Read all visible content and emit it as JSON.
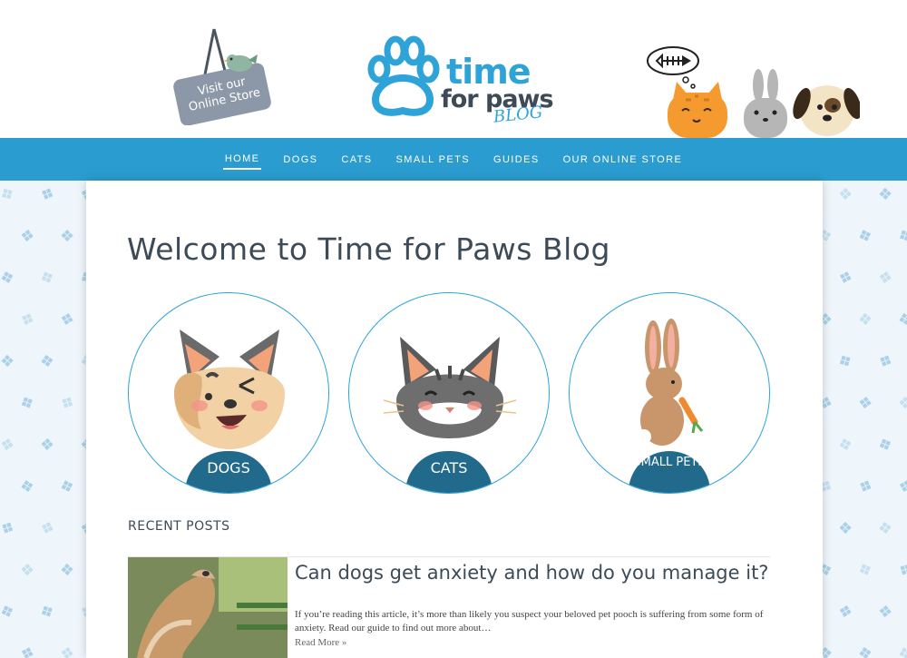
{
  "header": {
    "store_sign_label": "Visit our Online Store",
    "logo": {
      "time": "time",
      "for_paws": "for paws",
      "blog": "BLOG"
    }
  },
  "nav": {
    "items": [
      {
        "label": "HOME",
        "active": true
      },
      {
        "label": "DOGS",
        "active": false
      },
      {
        "label": "CATS",
        "active": false
      },
      {
        "label": "SMALL PETS",
        "active": false
      },
      {
        "label": "GUIDES",
        "active": false
      },
      {
        "label": "OUR ONLINE STORE",
        "active": false
      }
    ]
  },
  "main": {
    "title": "Welcome to Time for Paws Blog",
    "categories": [
      {
        "label": "DOGS",
        "icon": "dog-face-icon"
      },
      {
        "label": "CATS",
        "icon": "cat-face-icon"
      },
      {
        "label": "SMALL PETS",
        "icon": "rabbit-icon"
      }
    ],
    "recent_heading": "RECENT POSTS",
    "post": {
      "title": "Can dogs get anxiety and how do you manage it?",
      "excerpt": "If you’re reading this article, it’s more than likely you suspect your beloved pet pooch is suffering from some form of anxiety. Read our guide to find out more about…",
      "read_more": "Read More »"
    }
  },
  "colors": {
    "brand_blue": "#2b9ccf",
    "dark_teal": "#226a8c",
    "text_dark": "#3c4b57"
  }
}
